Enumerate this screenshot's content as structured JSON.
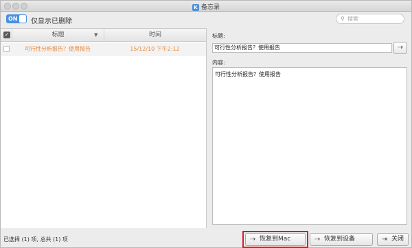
{
  "window": {
    "title": "备忘录"
  },
  "toolbar": {
    "toggle_label": "ON",
    "filter_label": "仅显示已删除",
    "search_placeholder": "搜索"
  },
  "list": {
    "columns": {
      "title": "标题",
      "time": "时间"
    },
    "rows": [
      {
        "title": "可行性分析报告？使用报告",
        "time": "15/12/10 下午2:12",
        "checked": false
      }
    ]
  },
  "detail": {
    "title_label": "标题:",
    "title_value": "可行性分析报告？使用报告",
    "content_label": "内容:",
    "content_value": "可行性分析报告？使用报告"
  },
  "status": {
    "selection_text": "已选择 (1) 项, 总共 (1) 项"
  },
  "buttons": {
    "restore_mac": "恢复到Mac",
    "restore_device": "恢复到设备",
    "close": "关闭"
  },
  "colors": {
    "accent": "#4a90e2",
    "row_text": "#e8883a",
    "highlight": "#d0202a"
  }
}
